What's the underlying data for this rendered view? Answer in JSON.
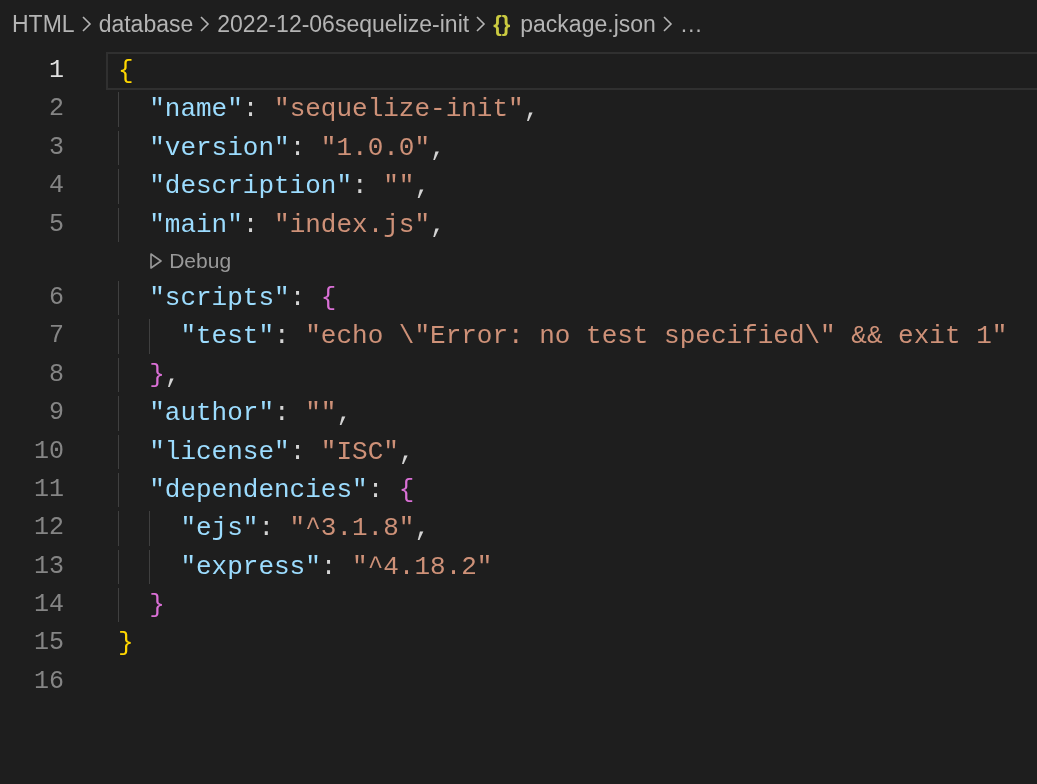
{
  "breadcrumbs": [
    {
      "text": "HTML"
    },
    {
      "text": "database"
    },
    {
      "text": "2022-12-06sequelize-init"
    },
    {
      "icon": "{}",
      "text": "package.json"
    },
    {
      "text": "…"
    }
  ],
  "lines": [
    {
      "kind": "line",
      "number": "1",
      "current": true,
      "tokens": [
        {
          "kind": "brace1",
          "text": "{"
        }
      ],
      "children": [
        {
          "kind": "line",
          "number": "2",
          "current": false,
          "tokens": [
            {
              "kind": "key",
              "text": "\"name\""
            },
            {
              "kind": "punct",
              "text": ": "
            },
            {
              "kind": "string",
              "text": "\"sequelize-init\""
            },
            {
              "kind": "punct",
              "text": ","
            }
          ]
        },
        {
          "kind": "line",
          "number": "3",
          "current": false,
          "tokens": [
            {
              "kind": "key",
              "text": "\"version\""
            },
            {
              "kind": "punct",
              "text": ": "
            },
            {
              "kind": "string",
              "text": "\"1.0.0\""
            },
            {
              "kind": "punct",
              "text": ","
            }
          ]
        },
        {
          "kind": "line",
          "number": "4",
          "current": false,
          "tokens": [
            {
              "kind": "key",
              "text": "\"description\""
            },
            {
              "kind": "punct",
              "text": ": "
            },
            {
              "kind": "string",
              "text": "\"\""
            },
            {
              "kind": "punct",
              "text": ","
            }
          ]
        },
        {
          "kind": "line",
          "number": "5",
          "current": false,
          "tokens": [
            {
              "kind": "key",
              "text": "\"main\""
            },
            {
              "kind": "punct",
              "text": ": "
            },
            {
              "kind": "string",
              "text": "\"index.js\""
            },
            {
              "kind": "punct",
              "text": ","
            }
          ]
        },
        {
          "kind": "codelens",
          "text": "Debug"
        },
        {
          "kind": "line",
          "number": "6",
          "current": false,
          "tokens": [
            {
              "kind": "key",
              "text": "\"scripts\""
            },
            {
              "kind": "punct",
              "text": ": "
            },
            {
              "kind": "brace2",
              "text": "{"
            }
          ],
          "children": [
            {
              "kind": "line",
              "number": "7",
              "current": false,
              "tokens": [
                {
                  "kind": "key",
                  "text": "\"test\""
                },
                {
                  "kind": "punct",
                  "text": ": "
                },
                {
                  "kind": "string",
                  "text": "\"echo \\\"Error: no test specified\\\" && exit 1\""
                }
              ]
            }
          ]
        },
        {
          "kind": "line",
          "number": "8",
          "current": false,
          "tokens": [
            {
              "kind": "brace2",
              "text": "}"
            },
            {
              "kind": "punct",
              "text": ","
            }
          ]
        },
        {
          "kind": "line",
          "number": "9",
          "current": false,
          "tokens": [
            {
              "kind": "key",
              "text": "\"author\""
            },
            {
              "kind": "punct",
              "text": ": "
            },
            {
              "kind": "string",
              "text": "\"\""
            },
            {
              "kind": "punct",
              "text": ","
            }
          ]
        },
        {
          "kind": "line",
          "number": "10",
          "current": false,
          "tokens": [
            {
              "kind": "key",
              "text": "\"license\""
            },
            {
              "kind": "punct",
              "text": ": "
            },
            {
              "kind": "string",
              "text": "\"ISC\""
            },
            {
              "kind": "punct",
              "text": ","
            }
          ]
        },
        {
          "kind": "line",
          "number": "11",
          "current": false,
          "tokens": [
            {
              "kind": "key",
              "text": "\"dependencies\""
            },
            {
              "kind": "punct",
              "text": ": "
            },
            {
              "kind": "brace2",
              "text": "{"
            }
          ],
          "children": [
            {
              "kind": "line",
              "number": "12",
              "current": false,
              "tokens": [
                {
                  "kind": "key",
                  "text": "\"ejs\""
                },
                {
                  "kind": "punct",
                  "text": ": "
                },
                {
                  "kind": "string",
                  "text": "\"^3.1.8\""
                },
                {
                  "kind": "punct",
                  "text": ","
                }
              ]
            },
            {
              "kind": "line",
              "number": "13",
              "current": false,
              "tokens": [
                {
                  "kind": "key",
                  "text": "\"express\""
                },
                {
                  "kind": "punct",
                  "text": ": "
                },
                {
                  "kind": "string",
                  "text": "\"^4.18.2\""
                }
              ]
            }
          ]
        },
        {
          "kind": "line",
          "number": "14",
          "current": false,
          "tokens": [
            {
              "kind": "brace2",
              "text": "}"
            }
          ]
        }
      ]
    },
    {
      "kind": "line",
      "number": "15",
      "current": false,
      "tokens": [
        {
          "kind": "brace1",
          "text": "}"
        }
      ]
    },
    {
      "kind": "line",
      "number": "16",
      "current": false
    }
  ]
}
